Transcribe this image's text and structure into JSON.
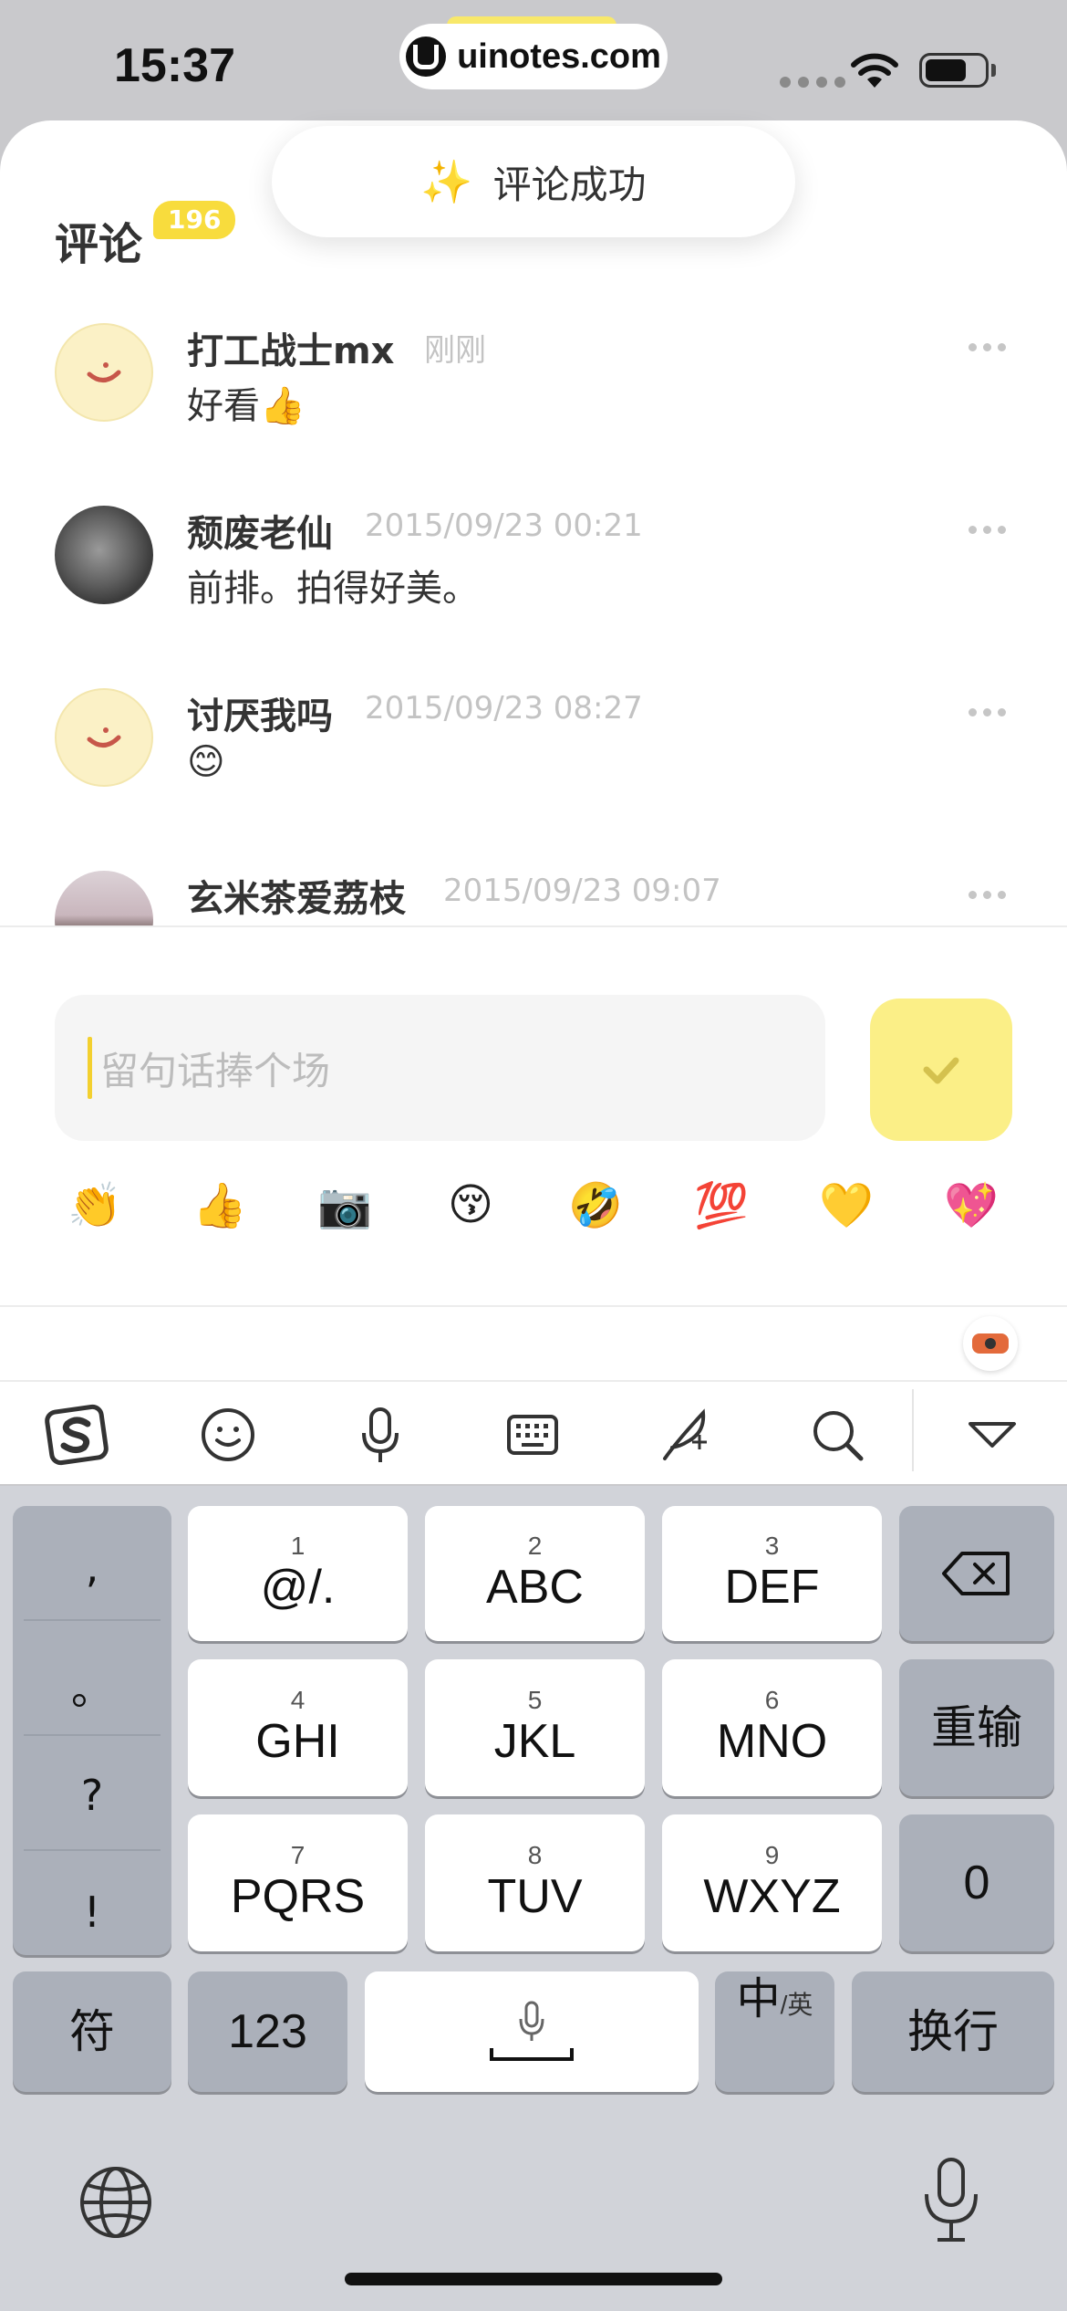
{
  "status_bar": {
    "time": "15:37",
    "url": "uinotes.com"
  },
  "toast": {
    "icon": "sparkles",
    "text": "评论成功"
  },
  "header": {
    "title": "评论",
    "count": "196"
  },
  "comments": [
    {
      "username": "打工战士mx",
      "time": "刚刚",
      "text": "好看👍",
      "avatar": "smile"
    },
    {
      "username": "颓废老仙",
      "time": "2015/09/23 00:21",
      "text": "前排。拍得好美。",
      "avatar": "photo"
    },
    {
      "username": "讨厌我吗",
      "time": "2015/09/23 08:27",
      "text": "😊",
      "avatar": "smile"
    },
    {
      "username": "玄米茶爱荔枝",
      "time": "2015/09/23 09:07",
      "text": "",
      "avatar": "photo2"
    }
  ],
  "composer": {
    "placeholder": "留句话捧个场"
  },
  "quick_emojis": [
    "👏",
    "👍",
    "📷",
    "😚",
    "🤣",
    "💯",
    "💛",
    "💖"
  ],
  "keyboard": {
    "punctuation": [
      ",",
      "。",
      "?",
      "!"
    ],
    "keys": [
      {
        "num": "1",
        "label": "@/."
      },
      {
        "num": "2",
        "label": "ABC"
      },
      {
        "num": "3",
        "label": "DEF"
      },
      {
        "num": "4",
        "label": "GHI"
      },
      {
        "num": "5",
        "label": "JKL"
      },
      {
        "num": "6",
        "label": "MNO"
      },
      {
        "num": "7",
        "label": "PQRS"
      },
      {
        "num": "8",
        "label": "TUV"
      },
      {
        "num": "9",
        "label": "WXYZ"
      }
    ],
    "reenter": "重输",
    "zero": "0",
    "symbols": "符",
    "numbers": "123",
    "lang_main": "中",
    "lang_sub": "/英",
    "return": "换行"
  }
}
